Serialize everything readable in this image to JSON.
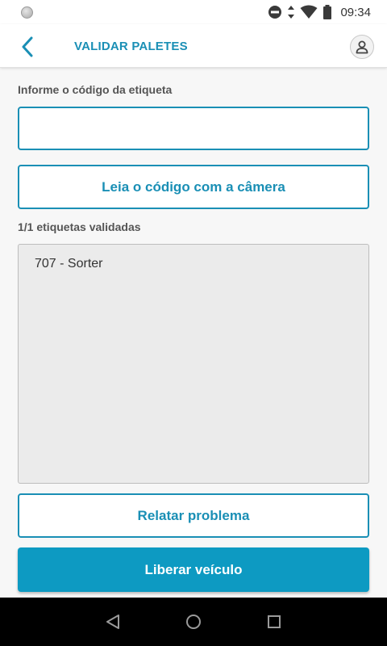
{
  "status_bar": {
    "time": "09:34",
    "icons": [
      "notification-dot-icon",
      "do-not-disturb-icon",
      "data-arrows-icon",
      "wifi-icon",
      "battery-icon"
    ]
  },
  "app_bar": {
    "title": "VALIDAR PALETES",
    "back_icon": "chevron-left-icon",
    "profile_icon": "person-icon"
  },
  "form": {
    "code_label": "Informe o código da etiqueta",
    "code_value": "",
    "code_placeholder": ""
  },
  "buttons": {
    "camera_label": "Leia o código com a câmera",
    "problem_label": "Relatar problema",
    "release_label": "Liberar veículo"
  },
  "validated": {
    "count_label": "1/1 etiquetas validadas",
    "items": [
      "707 - Sorter"
    ]
  },
  "nav": {
    "back_icon": "triangle-back-icon",
    "home_icon": "circle-home-icon",
    "recents_icon": "square-recents-icon"
  },
  "colors": {
    "accent": "#1a8fb5",
    "primary_button": "#0d9ac2",
    "list_background": "#ebebeb"
  }
}
